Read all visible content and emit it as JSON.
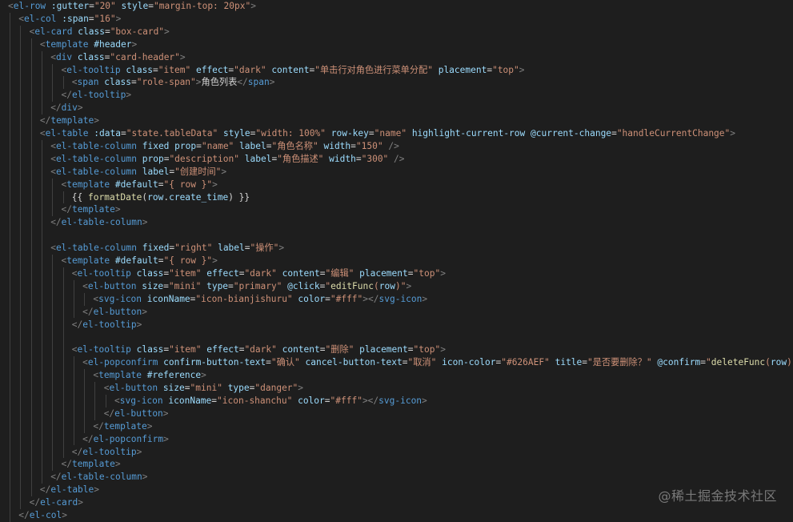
{
  "editor": {
    "lines": [
      [
        [
          "p",
          "<"
        ],
        [
          "t",
          "el-row"
        ],
        [
          "x",
          " "
        ],
        [
          "a",
          ":gutter"
        ],
        [
          "x",
          "="
        ],
        [
          "s",
          "\"20\""
        ],
        [
          "x",
          " "
        ],
        [
          "a",
          "style"
        ],
        [
          "x",
          "="
        ],
        [
          "s",
          "\"margin-top: 20px\""
        ],
        [
          "p",
          ">"
        ]
      ],
      [
        [
          "p",
          "<"
        ],
        [
          "t",
          "el-col"
        ],
        [
          "x",
          " "
        ],
        [
          "a",
          ":span"
        ],
        [
          "x",
          "="
        ],
        [
          "s",
          "\"16\""
        ],
        [
          "p",
          ">"
        ]
      ],
      [
        [
          "p",
          "<"
        ],
        [
          "t",
          "el-card"
        ],
        [
          "x",
          " "
        ],
        [
          "a",
          "class"
        ],
        [
          "x",
          "="
        ],
        [
          "s",
          "\"box-card\""
        ],
        [
          "p",
          ">"
        ]
      ],
      [
        [
          "p",
          "<"
        ],
        [
          "t",
          "template"
        ],
        [
          "x",
          " "
        ],
        [
          "a",
          "#header"
        ],
        [
          "p",
          ">"
        ]
      ],
      [
        [
          "p",
          "<"
        ],
        [
          "t",
          "div"
        ],
        [
          "x",
          " "
        ],
        [
          "a",
          "class"
        ],
        [
          "x",
          "="
        ],
        [
          "s",
          "\"card-header\""
        ],
        [
          "p",
          ">"
        ]
      ],
      [
        [
          "p",
          "<"
        ],
        [
          "t",
          "el-tooltip"
        ],
        [
          "x",
          " "
        ],
        [
          "a",
          "class"
        ],
        [
          "x",
          "="
        ],
        [
          "s",
          "\"item\""
        ],
        [
          "x",
          " "
        ],
        [
          "a",
          "effect"
        ],
        [
          "x",
          "="
        ],
        [
          "s",
          "\"dark\""
        ],
        [
          "x",
          " "
        ],
        [
          "a",
          "content"
        ],
        [
          "x",
          "="
        ],
        [
          "s",
          "\"单击行对角色进行菜单分配\""
        ],
        [
          "x",
          " "
        ],
        [
          "a",
          "placement"
        ],
        [
          "x",
          "="
        ],
        [
          "s",
          "\"top\""
        ],
        [
          "p",
          ">"
        ]
      ],
      [
        [
          "p",
          "<"
        ],
        [
          "t",
          "span"
        ],
        [
          "x",
          " "
        ],
        [
          "a",
          "class"
        ],
        [
          "x",
          "="
        ],
        [
          "s",
          "\"role-span\""
        ],
        [
          "p",
          ">"
        ],
        [
          "x",
          "角色列表"
        ],
        [
          "p",
          "</"
        ],
        [
          "t",
          "span"
        ],
        [
          "p",
          ">"
        ]
      ],
      [
        [
          "p",
          "</"
        ],
        [
          "t",
          "el-tooltip"
        ],
        [
          "p",
          ">"
        ]
      ],
      [
        [
          "p",
          "</"
        ],
        [
          "t",
          "div"
        ],
        [
          "p",
          ">"
        ]
      ],
      [
        [
          "p",
          "</"
        ],
        [
          "t",
          "template"
        ],
        [
          "p",
          ">"
        ]
      ],
      [
        [
          "p",
          "<"
        ],
        [
          "t",
          "el-table"
        ],
        [
          "x",
          " "
        ],
        [
          "a",
          ":data"
        ],
        [
          "x",
          "="
        ],
        [
          "s",
          "\"state.tableData\""
        ],
        [
          "x",
          " "
        ],
        [
          "a",
          "style"
        ],
        [
          "x",
          "="
        ],
        [
          "s",
          "\"width: 100%\""
        ],
        [
          "x",
          " "
        ],
        [
          "a",
          "row-key"
        ],
        [
          "x",
          "="
        ],
        [
          "s",
          "\"name\""
        ],
        [
          "x",
          " "
        ],
        [
          "a",
          "highlight-current-row"
        ],
        [
          "x",
          " "
        ],
        [
          "a",
          "@current-change"
        ],
        [
          "x",
          "="
        ],
        [
          "s",
          "\"handleCurrentChange\""
        ],
        [
          "p",
          ">"
        ]
      ],
      [
        [
          "p",
          "<"
        ],
        [
          "t",
          "el-table-column"
        ],
        [
          "x",
          " "
        ],
        [
          "a",
          "fixed"
        ],
        [
          "x",
          " "
        ],
        [
          "a",
          "prop"
        ],
        [
          "x",
          "="
        ],
        [
          "s",
          "\"name\""
        ],
        [
          "x",
          " "
        ],
        [
          "a",
          "label"
        ],
        [
          "x",
          "="
        ],
        [
          "s",
          "\"角色名称\""
        ],
        [
          "x",
          " "
        ],
        [
          "a",
          "width"
        ],
        [
          "x",
          "="
        ],
        [
          "s",
          "\"150\""
        ],
        [
          "x",
          " "
        ],
        [
          "p",
          "/>"
        ]
      ],
      [
        [
          "p",
          "<"
        ],
        [
          "t",
          "el-table-column"
        ],
        [
          "x",
          " "
        ],
        [
          "a",
          "prop"
        ],
        [
          "x",
          "="
        ],
        [
          "s",
          "\"description\""
        ],
        [
          "x",
          " "
        ],
        [
          "a",
          "label"
        ],
        [
          "x",
          "="
        ],
        [
          "s",
          "\"角色描述\""
        ],
        [
          "x",
          " "
        ],
        [
          "a",
          "width"
        ],
        [
          "x",
          "="
        ],
        [
          "s",
          "\"300\""
        ],
        [
          "x",
          " "
        ],
        [
          "p",
          "/>"
        ]
      ],
      [
        [
          "p",
          "<"
        ],
        [
          "t",
          "el-table-column"
        ],
        [
          "x",
          " "
        ],
        [
          "a",
          "label"
        ],
        [
          "x",
          "="
        ],
        [
          "s",
          "\"创建时间\""
        ],
        [
          "p",
          ">"
        ]
      ],
      [
        [
          "p",
          "<"
        ],
        [
          "t",
          "template"
        ],
        [
          "x",
          " "
        ],
        [
          "a",
          "#default"
        ],
        [
          "x",
          "="
        ],
        [
          "s",
          "\"{ row }\""
        ],
        [
          "p",
          ">"
        ]
      ],
      [
        [
          "x",
          "{{ "
        ],
        [
          "f",
          "formatDate"
        ],
        [
          "x",
          "("
        ],
        [
          "a",
          "row"
        ],
        [
          "x",
          "."
        ],
        [
          "a",
          "create_time"
        ],
        [
          "x",
          ") }}"
        ]
      ],
      [
        [
          "p",
          "</"
        ],
        [
          "t",
          "template"
        ],
        [
          "p",
          ">"
        ]
      ],
      [
        [
          "p",
          "</"
        ],
        [
          "t",
          "el-table-column"
        ],
        [
          "p",
          ">"
        ]
      ],
      [],
      [
        [
          "p",
          "<"
        ],
        [
          "t",
          "el-table-column"
        ],
        [
          "x",
          " "
        ],
        [
          "a",
          "fixed"
        ],
        [
          "x",
          "="
        ],
        [
          "s",
          "\"right\""
        ],
        [
          "x",
          " "
        ],
        [
          "a",
          "label"
        ],
        [
          "x",
          "="
        ],
        [
          "s",
          "\"操作\""
        ],
        [
          "p",
          ">"
        ]
      ],
      [
        [
          "p",
          "<"
        ],
        [
          "t",
          "template"
        ],
        [
          "x",
          " "
        ],
        [
          "a",
          "#default"
        ],
        [
          "x",
          "="
        ],
        [
          "s",
          "\"{ row }\""
        ],
        [
          "p",
          ">"
        ]
      ],
      [
        [
          "p",
          "<"
        ],
        [
          "t",
          "el-tooltip"
        ],
        [
          "x",
          " "
        ],
        [
          "a",
          "class"
        ],
        [
          "x",
          "="
        ],
        [
          "s",
          "\"item\""
        ],
        [
          "x",
          " "
        ],
        [
          "a",
          "effect"
        ],
        [
          "x",
          "="
        ],
        [
          "s",
          "\"dark\""
        ],
        [
          "x",
          " "
        ],
        [
          "a",
          "content"
        ],
        [
          "x",
          "="
        ],
        [
          "s",
          "\"编辑\""
        ],
        [
          "x",
          " "
        ],
        [
          "a",
          "placement"
        ],
        [
          "x",
          "="
        ],
        [
          "s",
          "\"top\""
        ],
        [
          "p",
          ">"
        ]
      ],
      [
        [
          "p",
          "<"
        ],
        [
          "t",
          "el-button"
        ],
        [
          "x",
          " "
        ],
        [
          "a",
          "size"
        ],
        [
          "x",
          "="
        ],
        [
          "s",
          "\"mini\""
        ],
        [
          "x",
          " "
        ],
        [
          "a",
          "type"
        ],
        [
          "x",
          "="
        ],
        [
          "s",
          "\"primary\""
        ],
        [
          "x",
          " "
        ],
        [
          "a",
          "@click"
        ],
        [
          "x",
          "="
        ],
        [
          "s",
          "\""
        ],
        [
          "f",
          "editFunc"
        ],
        [
          "s",
          "("
        ],
        [
          "a",
          "row"
        ],
        [
          "s",
          ")\""
        ],
        [
          "p",
          ">"
        ]
      ],
      [
        [
          "p",
          "<"
        ],
        [
          "t",
          "svg-icon"
        ],
        [
          "x",
          " "
        ],
        [
          "a",
          "iconName"
        ],
        [
          "x",
          "="
        ],
        [
          "s",
          "\"icon-bianjishuru\""
        ],
        [
          "x",
          " "
        ],
        [
          "a",
          "color"
        ],
        [
          "x",
          "="
        ],
        [
          "s",
          "\"#fff\""
        ],
        [
          "p",
          "></"
        ],
        [
          "t",
          "svg-icon"
        ],
        [
          "p",
          ">"
        ]
      ],
      [
        [
          "p",
          "</"
        ],
        [
          "t",
          "el-button"
        ],
        [
          "p",
          ">"
        ]
      ],
      [
        [
          "p",
          "</"
        ],
        [
          "t",
          "el-tooltip"
        ],
        [
          "p",
          ">"
        ]
      ],
      [],
      [
        [
          "p",
          "<"
        ],
        [
          "t",
          "el-tooltip"
        ],
        [
          "x",
          " "
        ],
        [
          "a",
          "class"
        ],
        [
          "x",
          "="
        ],
        [
          "s",
          "\"item\""
        ],
        [
          "x",
          " "
        ],
        [
          "a",
          "effect"
        ],
        [
          "x",
          "="
        ],
        [
          "s",
          "\"dark\""
        ],
        [
          "x",
          " "
        ],
        [
          "a",
          "content"
        ],
        [
          "x",
          "="
        ],
        [
          "s",
          "\"删除\""
        ],
        [
          "x",
          " "
        ],
        [
          "a",
          "placement"
        ],
        [
          "x",
          "="
        ],
        [
          "s",
          "\"top\""
        ],
        [
          "p",
          ">"
        ]
      ],
      [
        [
          "p",
          "<"
        ],
        [
          "t",
          "el-popconfirm"
        ],
        [
          "x",
          " "
        ],
        [
          "a",
          "confirm-button-text"
        ],
        [
          "x",
          "="
        ],
        [
          "s",
          "\"确认\""
        ],
        [
          "x",
          " "
        ],
        [
          "a",
          "cancel-button-text"
        ],
        [
          "x",
          "="
        ],
        [
          "s",
          "\"取消\""
        ],
        [
          "x",
          " "
        ],
        [
          "a",
          "icon-color"
        ],
        [
          "x",
          "="
        ],
        [
          "s",
          "\"#626AEF\""
        ],
        [
          "x",
          " "
        ],
        [
          "a",
          "title"
        ],
        [
          "x",
          "="
        ],
        [
          "s",
          "\"是否要删除？\""
        ],
        [
          "x",
          " "
        ],
        [
          "a",
          "@confirm"
        ],
        [
          "x",
          "="
        ],
        [
          "s",
          "\""
        ],
        [
          "f",
          "deleteFunc"
        ],
        [
          "s",
          "("
        ],
        [
          "a",
          "row"
        ],
        [
          "s",
          ")\""
        ],
        [
          "p",
          ">"
        ]
      ],
      [
        [
          "p",
          "<"
        ],
        [
          "t",
          "template"
        ],
        [
          "x",
          " "
        ],
        [
          "a",
          "#reference"
        ],
        [
          "p",
          ">"
        ]
      ],
      [
        [
          "p",
          "<"
        ],
        [
          "t",
          "el-button"
        ],
        [
          "x",
          " "
        ],
        [
          "a",
          "size"
        ],
        [
          "x",
          "="
        ],
        [
          "s",
          "\"mini\""
        ],
        [
          "x",
          " "
        ],
        [
          "a",
          "type"
        ],
        [
          "x",
          "="
        ],
        [
          "s",
          "\"danger\""
        ],
        [
          "p",
          ">"
        ]
      ],
      [
        [
          "p",
          "<"
        ],
        [
          "t",
          "svg-icon"
        ],
        [
          "x",
          " "
        ],
        [
          "a",
          "iconName"
        ],
        [
          "x",
          "="
        ],
        [
          "s",
          "\"icon-shanchu\""
        ],
        [
          "x",
          " "
        ],
        [
          "a",
          "color"
        ],
        [
          "x",
          "="
        ],
        [
          "s",
          "\"#fff\""
        ],
        [
          "p",
          "></"
        ],
        [
          "t",
          "svg-icon"
        ],
        [
          "p",
          ">"
        ]
      ],
      [
        [
          "p",
          "</"
        ],
        [
          "t",
          "el-button"
        ],
        [
          "p",
          ">"
        ]
      ],
      [
        [
          "p",
          "</"
        ],
        [
          "t",
          "template"
        ],
        [
          "p",
          ">"
        ]
      ],
      [
        [
          "p",
          "</"
        ],
        [
          "t",
          "el-popconfirm"
        ],
        [
          "p",
          ">"
        ]
      ],
      [
        [
          "p",
          "</"
        ],
        [
          "t",
          "el-tooltip"
        ],
        [
          "p",
          ">"
        ]
      ],
      [
        [
          "p",
          "</"
        ],
        [
          "t",
          "template"
        ],
        [
          "p",
          ">"
        ]
      ],
      [
        [
          "p",
          "</"
        ],
        [
          "t",
          "el-table-column"
        ],
        [
          "p",
          ">"
        ]
      ],
      [
        [
          "p",
          "</"
        ],
        [
          "t",
          "el-table"
        ],
        [
          "p",
          ">"
        ]
      ],
      [
        [
          "p",
          "</"
        ],
        [
          "t",
          "el-card"
        ],
        [
          "p",
          ">"
        ]
      ],
      [
        [
          "p",
          "</"
        ],
        [
          "t",
          "el-col"
        ],
        [
          "p",
          ">"
        ]
      ]
    ]
  },
  "watermark": "@稀土掘金技术社区"
}
